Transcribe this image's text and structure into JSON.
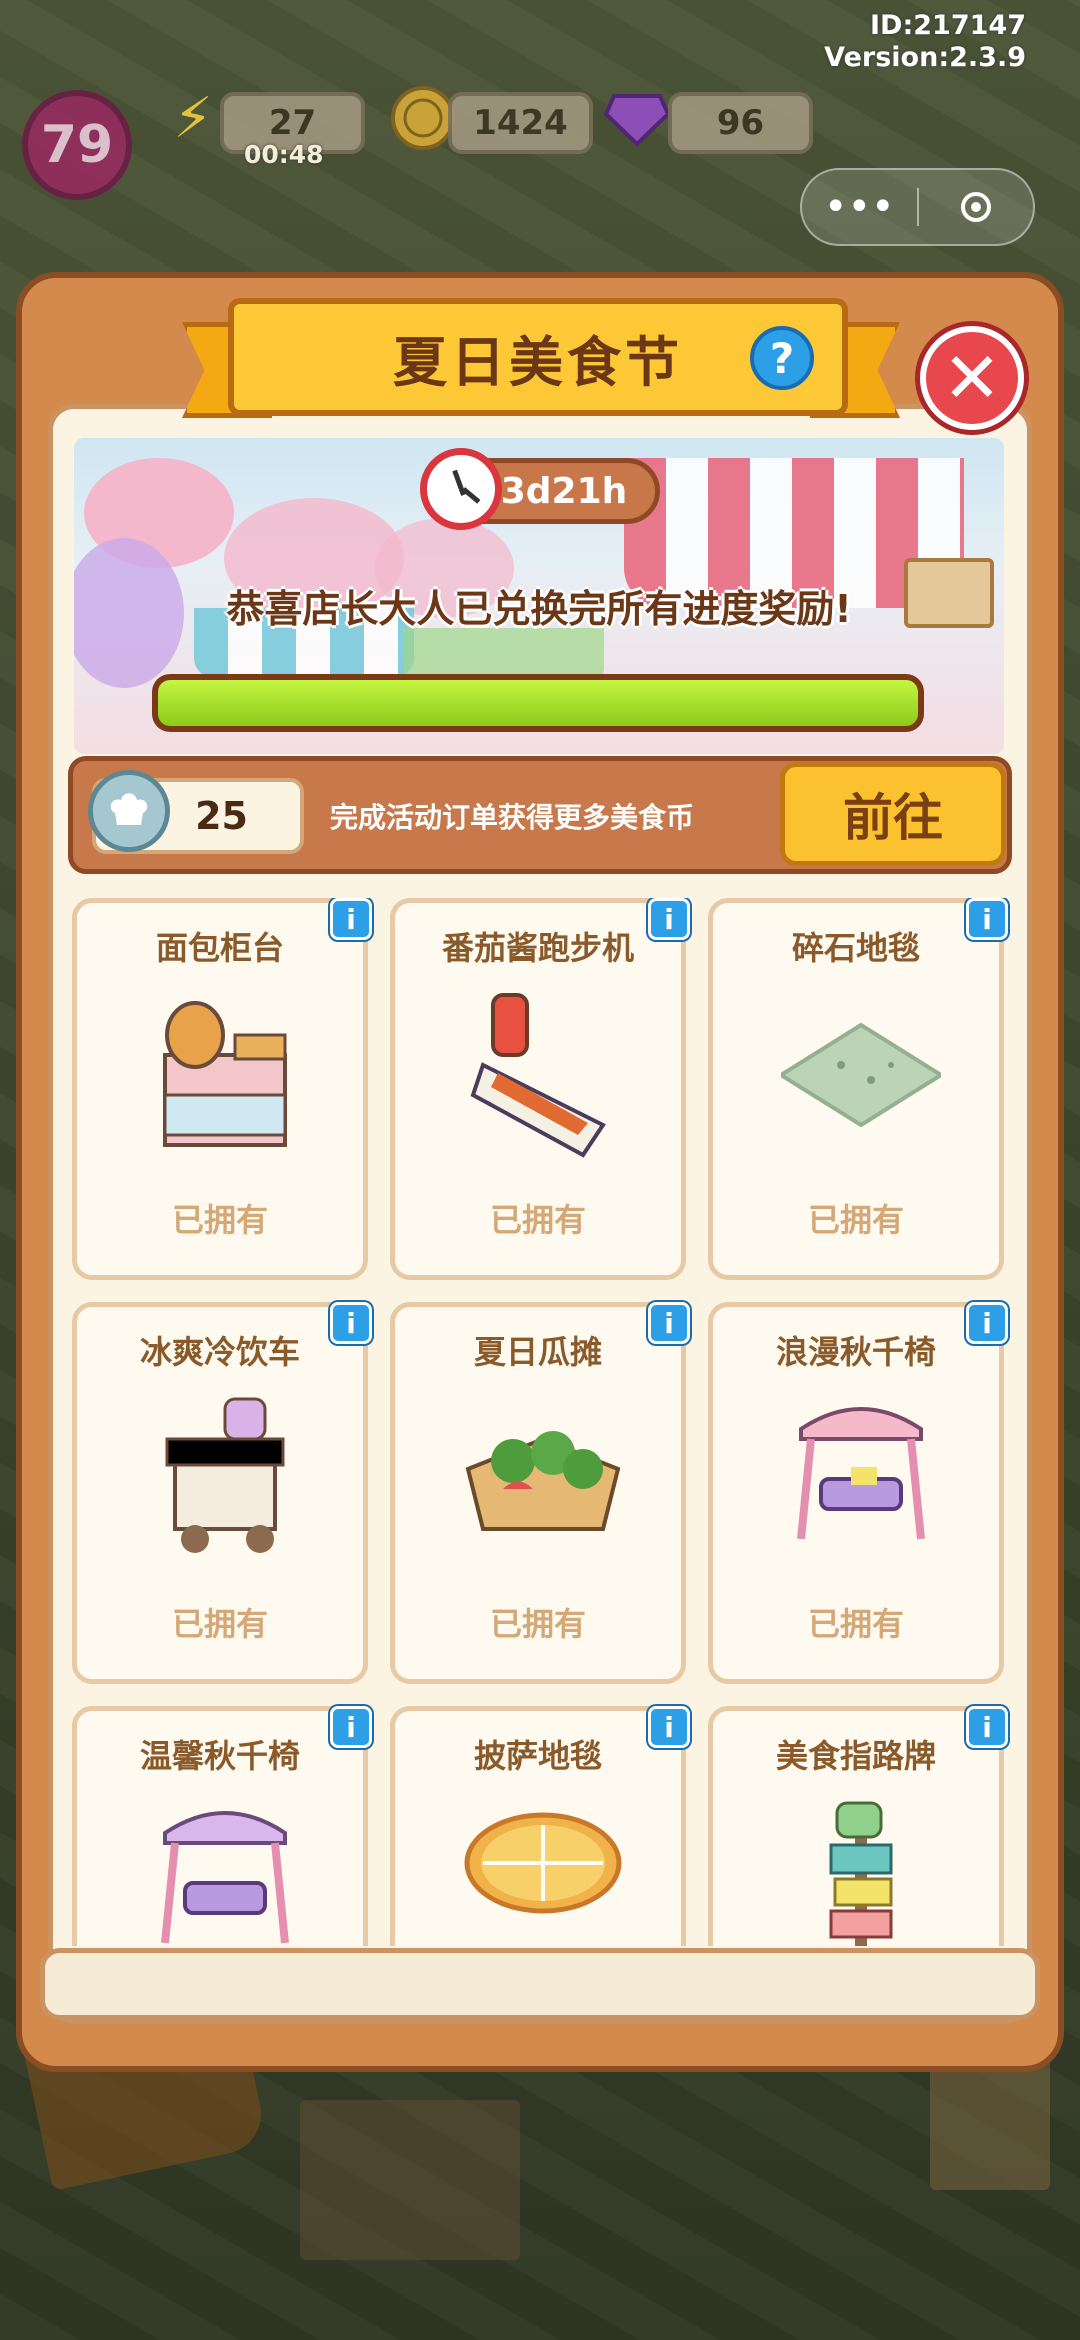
{
  "system": {
    "id_text": "ID:217147",
    "version_text": "Version:2.3.9"
  },
  "hud": {
    "level": "79",
    "energy": "27",
    "energy_timer": "00:48",
    "coins": "1424",
    "gems": "96"
  },
  "capsule": {
    "more_label": "•••"
  },
  "panel": {
    "title": "夏日美食节",
    "help_label": "?",
    "close_label": "✕",
    "timer": "3d21h",
    "congrats": "恭喜店长大人已兑换完所有进度奖励!",
    "progress_percent": 100,
    "currency_count": "25",
    "currency_desc": "完成活动订单获得更多美食币",
    "go_label": "前往"
  },
  "items": [
    {
      "name": "面包柜台",
      "status": "已拥有",
      "info": "i",
      "icon": "bread-counter-icon"
    },
    {
      "name": "番茄酱跑步机",
      "status": "已拥有",
      "info": "i",
      "icon": "ketchup-treadmill-icon"
    },
    {
      "name": "碎石地毯",
      "status": "已拥有",
      "info": "i",
      "icon": "gravel-rug-icon"
    },
    {
      "name": "冰爽冷饮车",
      "status": "已拥有",
      "info": "i",
      "icon": "cold-drink-cart-icon"
    },
    {
      "name": "夏日瓜摊",
      "status": "已拥有",
      "info": "i",
      "icon": "watermelon-stall-icon"
    },
    {
      "name": "浪漫秋千椅",
      "status": "已拥有",
      "info": "i",
      "icon": "romantic-swing-icon"
    },
    {
      "name": "温馨秋千椅",
      "status": "",
      "info": "i",
      "icon": "cozy-swing-icon"
    },
    {
      "name": "披萨地毯",
      "status": "",
      "info": "i",
      "icon": "pizza-rug-icon"
    },
    {
      "name": "美食指路牌",
      "status": "",
      "info": "i",
      "icon": "food-signpost-icon"
    }
  ],
  "colors": {
    "accent": "#fcc835",
    "progress": "#a6e02b",
    "info": "#2c9fe6",
    "close": "#e7474d"
  }
}
